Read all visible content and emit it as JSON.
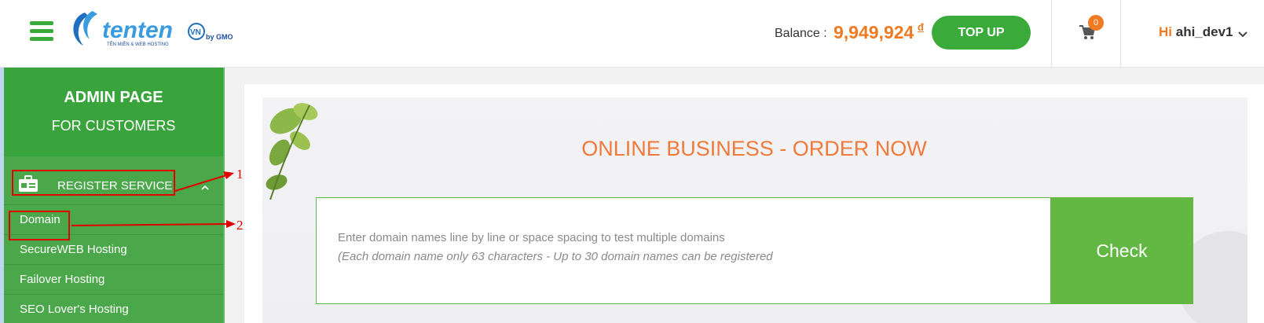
{
  "header": {
    "logo_text": "tenten",
    "logo_suffix": "VN",
    "logo_by": "by GMO",
    "logo_tagline": "TÊN MIỀN & WEB HOSTING",
    "balance_label": "Balance :",
    "balance_value": "9,949,924",
    "balance_currency": "đ",
    "topup_label": "TOP UP",
    "cart_count": "0",
    "greeting_hi": "Hi",
    "username": "ahi_dev1"
  },
  "sidebar": {
    "title": "ADMIN PAGE",
    "subtitle": "FOR CUSTOMERS",
    "register_label": "REGISTER SERVICE",
    "items": [
      {
        "label": "Domain"
      },
      {
        "label": "SecureWEB Hosting"
      },
      {
        "label": "Failover Hosting"
      },
      {
        "label": "SEO Lover's Hosting"
      }
    ]
  },
  "annotations": {
    "marker1": "1",
    "marker2": "2"
  },
  "main": {
    "headline": "ONLINE BUSINESS - ORDER NOW",
    "search_placeholder_line1": "Enter domain names line by line or space spacing to test multiple domains",
    "search_placeholder_line2": "(Each domain name only 63 characters - Up to 30 domain names can be registered",
    "check_label": "Check"
  },
  "colors": {
    "brand_green": "#3aaa3a",
    "accent_orange": "#f07a22",
    "annotation_red": "#e00000"
  }
}
